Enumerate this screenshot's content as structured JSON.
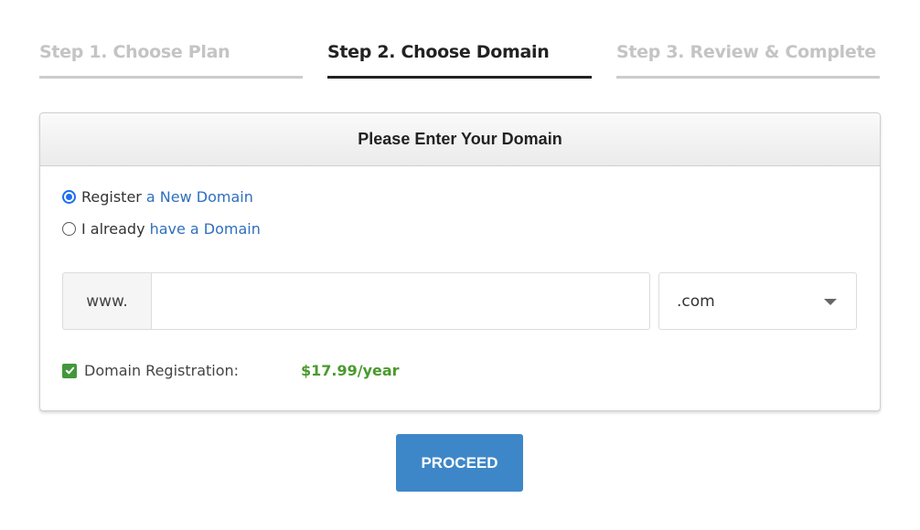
{
  "steps": [
    {
      "label": "Step 1. Choose Plan",
      "active": false
    },
    {
      "label": "Step 2. Choose Domain",
      "active": true
    },
    {
      "label": "Step 3. Review & Complete",
      "active": false
    }
  ],
  "panel": {
    "title": "Please Enter Your Domain",
    "options": [
      {
        "prefix": "Register",
        "link": "a New Domain",
        "selected": true
      },
      {
        "prefix": "I already",
        "link": "have a Domain",
        "selected": false
      }
    ],
    "domain_prefix": "www.",
    "domain_value": "",
    "domain_placeholder": "",
    "tld_selected": ".com",
    "registration": {
      "label": "Domain Registration:",
      "price": "$17.99/year",
      "checked": true
    }
  },
  "proceed_label": "PROCEED",
  "colors": {
    "accent_blue": "#3d87c8",
    "link_blue": "#2f6fbd",
    "price_green": "#4a9a2e",
    "checkbox_green": "#43973a"
  }
}
